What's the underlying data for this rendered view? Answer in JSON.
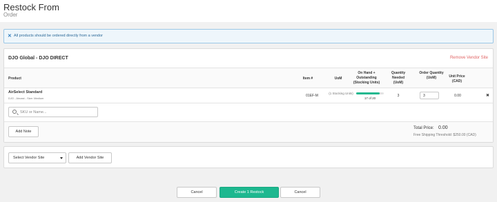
{
  "header": {
    "title": "Restock From",
    "subtitle": "Order"
  },
  "alert": {
    "icon": "close-icon",
    "text": "All products should be ordered directly from a vendor"
  },
  "vendor": {
    "name": "DJO Global - DJO DIRECT",
    "remove_label": "Remove Vendor Site",
    "remove_color": "#e06464"
  },
  "table": {
    "columns": {
      "product": "Product",
      "item": "Item #",
      "uom": "UoM",
      "onhand": "On Hand + Outstanding (Stocking Units)",
      "qty_needed": "Quantity Needed (UoM)",
      "order_qty": "Order Quantity (UoM)",
      "unit_price": "Unit Price (CAD)"
    },
    "rows": [
      {
        "product_name": "AirSelect Standard",
        "product_desc": "DJO - Aircast - Size: Medium",
        "item": "01EF-M",
        "uom": "(1 Stocking Units)",
        "onhand_label": "17 of 20",
        "onhand_fraction": 0.85,
        "qty_needed": "3",
        "order_qty": "3",
        "unit_price": "0.00",
        "remove_icon": "close-icon"
      }
    ]
  },
  "search": {
    "placeholder": "SKU or Name..."
  },
  "footer": {
    "add_note_label": "Add Note",
    "total_label": "Total Price:",
    "total_value": "0.00",
    "shipping_threshold": "Free Shipping Threshold: $250.00 (CAD)"
  },
  "add_vendor": {
    "select_label": "Select Vendor Site",
    "add_button_label": "Add Vendor Site"
  },
  "actions": {
    "cancel_label": "Cancel",
    "create_label": "Create 1 Restock",
    "accent_color": "#1db88f"
  }
}
